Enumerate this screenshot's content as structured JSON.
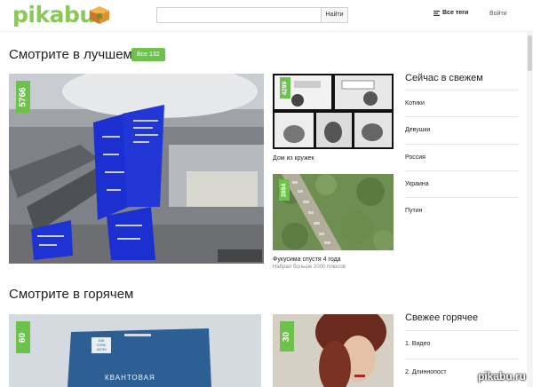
{
  "header": {
    "logo_text": "pikabu",
    "search_placeholder": "",
    "search_button": "Найти",
    "tags_label": "Все теги",
    "login_label": "Войти"
  },
  "best": {
    "title": "Смотрите в лучшем",
    "all_badge": "Все 132",
    "main_tile": {
      "count": "5766"
    },
    "tiles": [
      {
        "count": "4299",
        "caption": "Дом из кружек",
        "subcaption": ""
      },
      {
        "count": "3984",
        "caption": "Фукусима спустя 4 года",
        "subcaption": "Набрал больше 2000 плюсов"
      }
    ]
  },
  "fresh": {
    "title": "Сейчас в свежем",
    "items": [
      "Котики",
      "Девушки",
      "Россия",
      "Украина",
      "Путин"
    ]
  },
  "hot": {
    "title": "Смотрите в горячем",
    "tiles": [
      {
        "count": "60",
        "book_label": "КВАНТОВАЯ"
      },
      {
        "count": "30"
      }
    ]
  },
  "fresh_hot": {
    "title": "Свежее горячее",
    "items": [
      "1. Видео",
      "2. Длиннопост"
    ]
  },
  "watermark": "pikabu.ru",
  "colors": {
    "accent_green": "#6cc24a",
    "logo_green": "#8ac858",
    "bsod_blue": "#1c2fd0"
  }
}
